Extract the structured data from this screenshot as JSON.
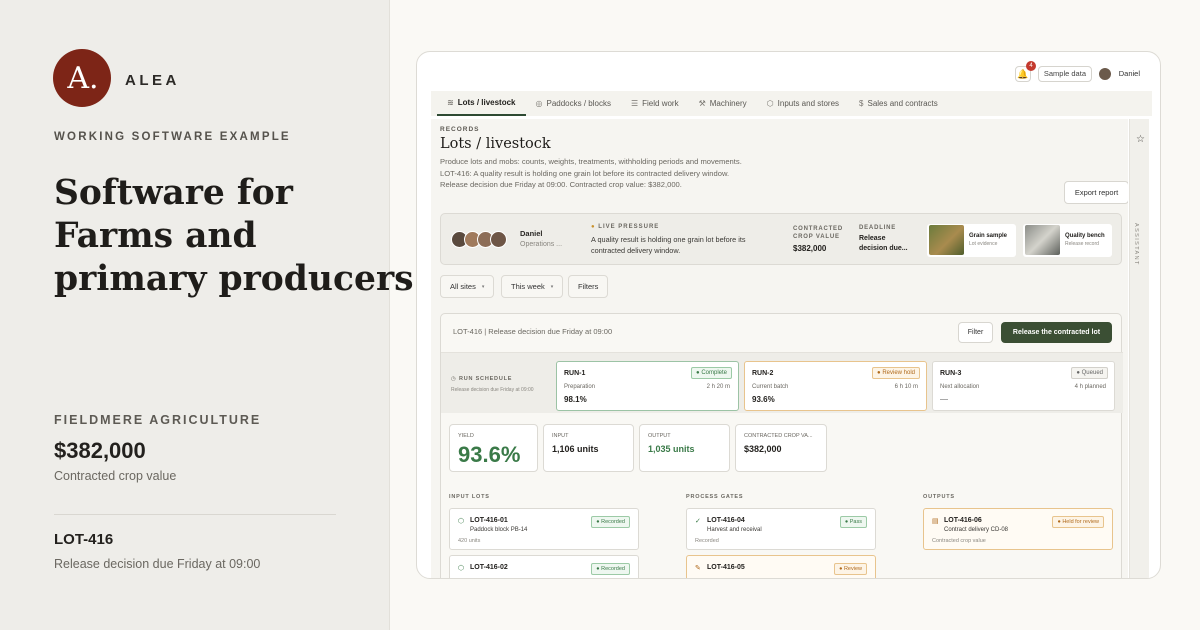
{
  "brand": {
    "logo_letter": "A.",
    "name": "ALEA",
    "accent": "#7d2517"
  },
  "hero": {
    "eyebrow": "WORKING SOFTWARE EXAMPLE",
    "headline": "Software for Farms and primary producers",
    "company": "FIELDMERE AGRICULTURE",
    "value": "$382,000",
    "value_caption": "Contracted crop value",
    "lot": "LOT-416",
    "lot_caption": "Release decision due Friday at 09:00"
  },
  "app": {
    "topbar": {
      "bell_icon": "bell-icon",
      "notification_count": "4",
      "sample_label": "Sample data",
      "user_name": "Daniel"
    },
    "tabs": [
      {
        "label": "Lots / livestock",
        "icon": "layers-icon",
        "glyph": "≋"
      },
      {
        "label": "Paddocks / blocks",
        "icon": "map-pin-icon",
        "glyph": "◎"
      },
      {
        "label": "Field work",
        "icon": "list-icon",
        "glyph": "☰"
      },
      {
        "label": "Machinery",
        "icon": "wrench-icon",
        "glyph": "⚒"
      },
      {
        "label": "Inputs and stores",
        "icon": "box-icon",
        "glyph": "⬡"
      },
      {
        "label": "Sales and contracts",
        "icon": "dollar-icon",
        "glyph": "$"
      }
    ],
    "rail": {
      "star_icon": "star-icon",
      "label": "ASSISTANT"
    },
    "page": {
      "section": "RECORDS",
      "title": "Lots / livestock",
      "description": "Produce lots and mobs: counts, weights, treatments, withholding periods and movements. LOT-416: A quality result is holding one grain lot before its contracted delivery window. Release decision due Friday at 09:00. Contracted crop value: $382,000.",
      "export_label": "Export report"
    },
    "pressure": {
      "person": "Daniel",
      "role": "Operations ...",
      "label": "LIVE PRESSURE",
      "text": "A quality result is holding one grain lot before its contracted delivery window.",
      "value_label": "CONTRACTED CROP VALUE",
      "value": "$382,000",
      "deadline_label": "DEADLINE",
      "deadline": "Release decision due...",
      "thumbs": [
        {
          "title": "Grain sample",
          "sub": "Lot evidence"
        },
        {
          "title": "Quality bench",
          "sub": "Release record"
        }
      ]
    },
    "filters": [
      {
        "label": "All sites",
        "chevron": "▾"
      },
      {
        "label": "This week",
        "chevron": "▾"
      },
      {
        "label": "Filters",
        "chevron": ""
      }
    ],
    "panel": {
      "header": "LOT-416 | Release decision due Friday at 09:00",
      "filter_label": "Filter",
      "release_label": "Release the contracted lot",
      "schedule_label": "RUN SCHEDULE",
      "schedule_sub": "Release decision due Friday at 09:00",
      "runs": [
        {
          "title": "RUN-1",
          "badge": "Complete",
          "label": "Preparation",
          "time": "2 h 20 m",
          "value": "98.1%"
        },
        {
          "title": "RUN-2",
          "badge": "Review hold",
          "label": "Current batch",
          "time": "6 h 10 m",
          "value": "93.6%"
        },
        {
          "title": "RUN-3",
          "badge": "Queued",
          "label": "Next allocation",
          "time": "4 h planned",
          "value": "—"
        }
      ],
      "metrics": [
        {
          "label": "YIELD",
          "value": "93.6%"
        },
        {
          "label": "INPUT",
          "value": "1,106 units"
        },
        {
          "label": "OUTPUT",
          "value": "1,035 units"
        },
        {
          "label": "CONTRACTED CROP VA...",
          "value": "$382,000"
        }
      ],
      "columns": {
        "input": {
          "heading": "INPUT LOTS",
          "cards": [
            {
              "title": "LOT-416-01",
              "sub": "Paddock block PB-14",
              "meta": "420 units",
              "badge": "Recorded",
              "glyph": "⬡"
            },
            {
              "title": "LOT-416-02",
              "sub": "",
              "meta": "",
              "badge": "Recorded",
              "glyph": "⬡"
            }
          ]
        },
        "process": {
          "heading": "PROCESS GATES",
          "cards": [
            {
              "title": "LOT-416-04",
              "sub": "Harvest and receival",
              "meta": "Recorded",
              "badge": "Pass",
              "glyph": "✓"
            },
            {
              "title": "LOT-416-05",
              "sub": "",
              "meta": "",
              "badge": "Review",
              "glyph": "✎"
            }
          ]
        },
        "outputs": {
          "heading": "OUTPUTS",
          "cards": [
            {
              "title": "LOT-416-06",
              "sub": "Contract delivery CD-08",
              "meta": "Contracted crop value",
              "badge": "Held for review",
              "glyph": "▤"
            }
          ]
        }
      }
    }
  }
}
